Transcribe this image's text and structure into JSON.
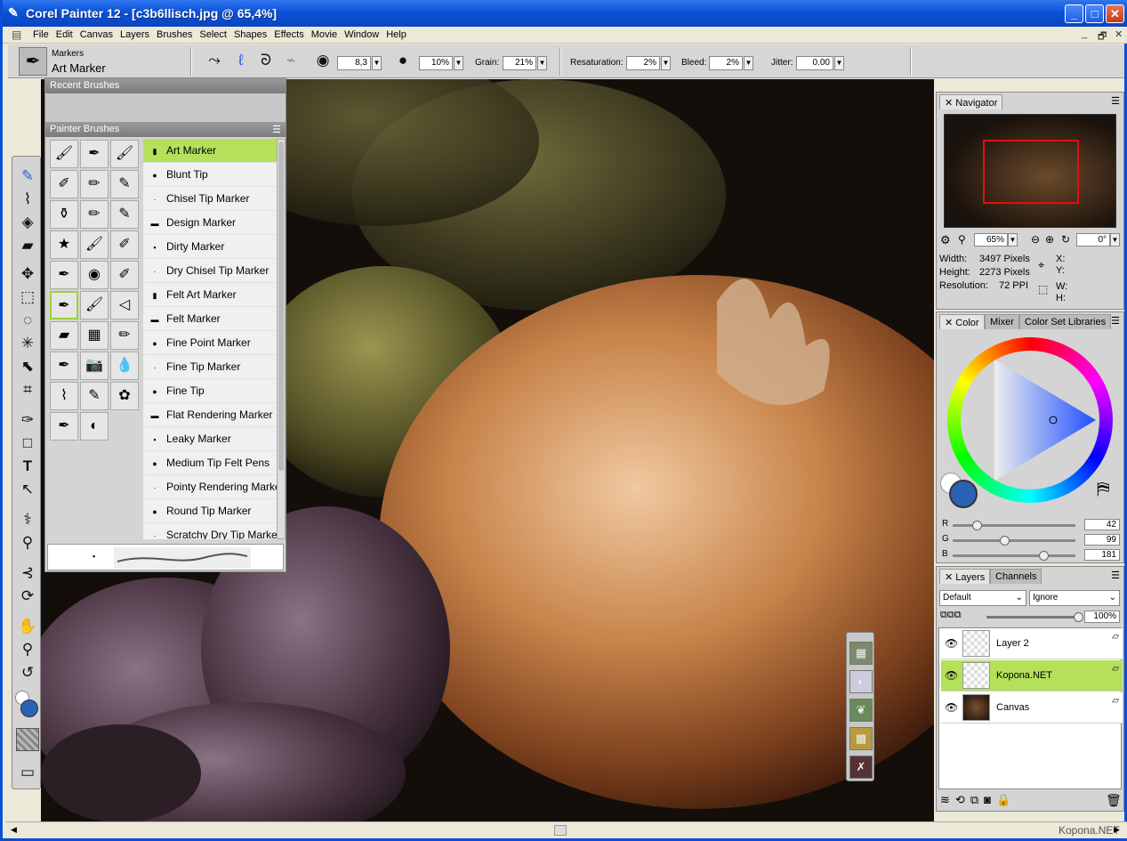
{
  "window": {
    "title": "Corel Painter 12 - [c3b6llisch.jpg @ 65,4%]",
    "minimize": "_",
    "maximize": "□",
    "close": "✕"
  },
  "menu": [
    "File",
    "Edit",
    "Canvas",
    "Layers",
    "Brushes",
    "Select",
    "Shapes",
    "Effects",
    "Movie",
    "Window",
    "Help"
  ],
  "mdi_controls": [
    "_",
    "🗗",
    "✕"
  ],
  "property_bar": {
    "category": "Markers",
    "variant": "Art Marker",
    "size": "8,3",
    "opacity": "10%",
    "grain_label": "Grain:",
    "grain": "21%",
    "resaturation_label": "Resaturation:",
    "resaturation": "2%",
    "bleed_label": "Bleed:",
    "bleed": "2%",
    "jitter_label": "Jitter:",
    "jitter": "0.00"
  },
  "brush_panel": {
    "recent_title": "Recent Brushes",
    "title": "Painter Brushes",
    "brushes": [
      "Art Marker",
      "Blunt Tip",
      "Chisel Tip Marker",
      "Design Marker",
      "Dirty Marker",
      "Dry Chisel Tip Marker",
      "Felt Art Marker",
      "Felt Marker",
      "Fine Point Marker",
      "Fine Tip Marker",
      "Fine Tip",
      "Flat Rendering Marker",
      "Leaky Marker",
      "Medium Tip Felt Pens",
      "Pointy Rendering Marker",
      "Round Tip Marker",
      "Scratchy Dry Tip Marker"
    ],
    "selected": "Art Marker"
  },
  "navigator": {
    "tab": "Navigator",
    "zoom": "65%",
    "rotation": "0°",
    "width_label": "Width:",
    "width": "3497 Pixels",
    "height_label": "Height:",
    "height": "2273 Pixels",
    "resolution_label": "Resolution:",
    "resolution": "72 PPI",
    "x_label": "X:",
    "y_label": "Y:",
    "w_label": "W:",
    "h_label": "H:"
  },
  "color_panel": {
    "tabs": [
      "Color",
      "Mixer",
      "Color Set Libraries"
    ],
    "r_label": "R",
    "r": "42",
    "g_label": "G",
    "g": "99",
    "b_label": "B",
    "b": "181",
    "main_color": "#2a63b5"
  },
  "layers_panel": {
    "tabs": [
      "Layers",
      "Channels"
    ],
    "blend": "Default",
    "composite": "Ignore",
    "opacity": "100%",
    "layers": [
      {
        "name": "Layer 2",
        "selected": false
      },
      {
        "name": "Kopona.NET",
        "selected": true
      },
      {
        "name": "Canvas",
        "selected": false
      }
    ]
  },
  "watermark": "Kopona.NET"
}
